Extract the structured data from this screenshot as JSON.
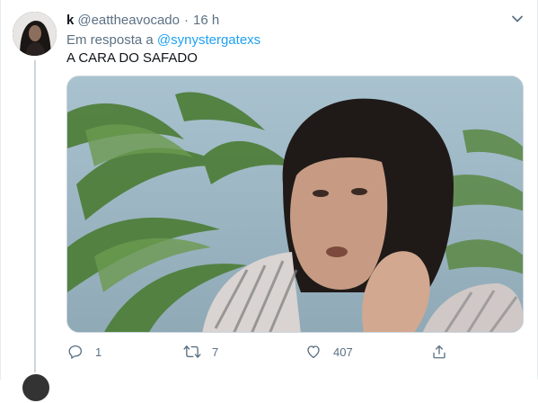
{
  "tweet": {
    "display_name": "k",
    "handle": "@eattheavocado",
    "separator": "·",
    "time": "16 h",
    "reply_prefix": "Em resposta a",
    "reply_mention": "@synystergatexs",
    "text": "A CARA DO SAFADO",
    "media_description_icon": "video-still-image",
    "actions": {
      "reply_count": "1",
      "retweet_count": "7",
      "like_count": "407",
      "share_count": ""
    }
  },
  "colors": {
    "secondary_text": "#5b7083",
    "link": "#1da1f2",
    "thread_line": "#ccd6dd",
    "border": "#e6ecf0"
  },
  "icons": {
    "caret": "chevron-down-icon",
    "reply": "reply-icon",
    "retweet": "retweet-icon",
    "like": "heart-icon",
    "share": "share-icon"
  }
}
